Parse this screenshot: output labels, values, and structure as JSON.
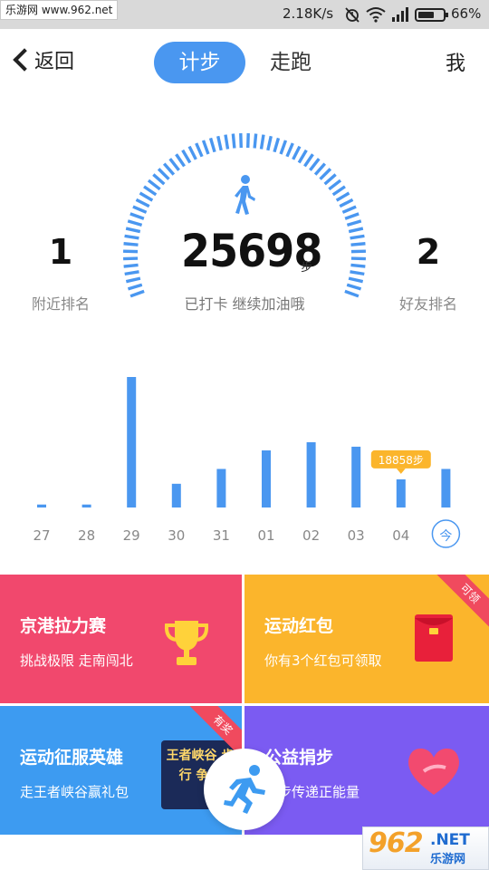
{
  "status_bar": {
    "watermark": "乐游网 www.962.net",
    "net_speed": "2.18K/s",
    "battery_pct": "66%",
    "battery_level": 0.66,
    "icons": [
      "alarm-off-icon",
      "wifi-icon",
      "signal-icon",
      "battery-icon"
    ]
  },
  "nav": {
    "back_label": "返回",
    "tabs": [
      {
        "label": "计步",
        "active": true
      },
      {
        "label": "走跑",
        "active": false
      }
    ],
    "me_label": "我"
  },
  "summary": {
    "steps": "25698",
    "unit": "步",
    "caption": "已打卡  继续加油哦",
    "gauge_progress": 1.0,
    "nearby_rank": "1",
    "nearby_label": "附近排名",
    "friend_rank": "2",
    "friend_label": "好友排名"
  },
  "chart_data": {
    "type": "bar",
    "categories": [
      "27",
      "28",
      "29",
      "30",
      "31",
      "01",
      "02",
      "03",
      "04",
      "今"
    ],
    "values": [
      400,
      400,
      17600,
      3200,
      5200,
      7700,
      8800,
      8200,
      3800,
      5200
    ],
    "highlight_index": 8,
    "highlight_label": "18858步",
    "today_index": 9,
    "ylim": [
      0,
      17600
    ],
    "bar_color": "#4a97f0",
    "label_color": "#888888"
  },
  "cards": [
    {
      "title": "京港拉力赛",
      "subtitle": "挑战极限 走南闯北",
      "color": "#f1486d",
      "icon": "trophy-icon"
    },
    {
      "title": "运动红包",
      "subtitle": "你有3个红包可领取",
      "color": "#fbb52c",
      "icon": "red-envelope-icon",
      "badge": "可领"
    },
    {
      "title": "运动征服英雄",
      "subtitle": "走王者峡谷赢礼包",
      "color": "#3d9bf1",
      "icon": "game-promo-icon",
      "badge": "有奖",
      "promo_text": "王者峡谷 步行 争霸"
    },
    {
      "title": "公益捐步",
      "subtitle": "脚步传递正能量",
      "color": "#7b5bf2",
      "icon": "heart-icon"
    }
  ],
  "fab": {
    "icon": "running-man-icon"
  },
  "watermark": {
    "logo": "962",
    "net": ".NET",
    "cn": "乐游网"
  }
}
